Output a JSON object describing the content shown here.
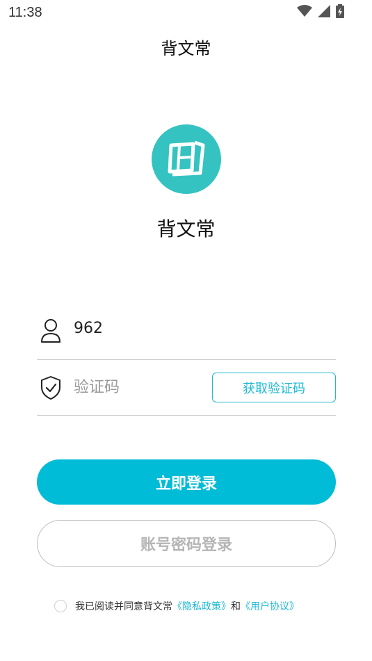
{
  "status_bar": {
    "time": "11:38",
    "icons": [
      "wifi-icon",
      "cellular-signal-icon",
      "battery-charging-icon"
    ]
  },
  "header": {
    "title": "背文常"
  },
  "logo": {
    "icon": "book-icon",
    "background": "#34c3c1"
  },
  "app_name": "背文常",
  "form": {
    "phone": {
      "icon": "user-icon",
      "value": "962"
    },
    "code": {
      "icon": "shield-check-icon",
      "placeholder": "验证码",
      "value": ""
    },
    "get_code_label": "获取验证码"
  },
  "buttons": {
    "login_label": "立即登录",
    "password_login_label": "账号密码登录"
  },
  "agreement": {
    "prefix": "我已阅读并同意背文常",
    "privacy_link": "《隐私政策》",
    "conjunction": "和",
    "terms_link": "《用户协议》"
  },
  "colors": {
    "accent": "#00bcd6",
    "link": "#1db9d4",
    "logo": "#34c3c1"
  }
}
